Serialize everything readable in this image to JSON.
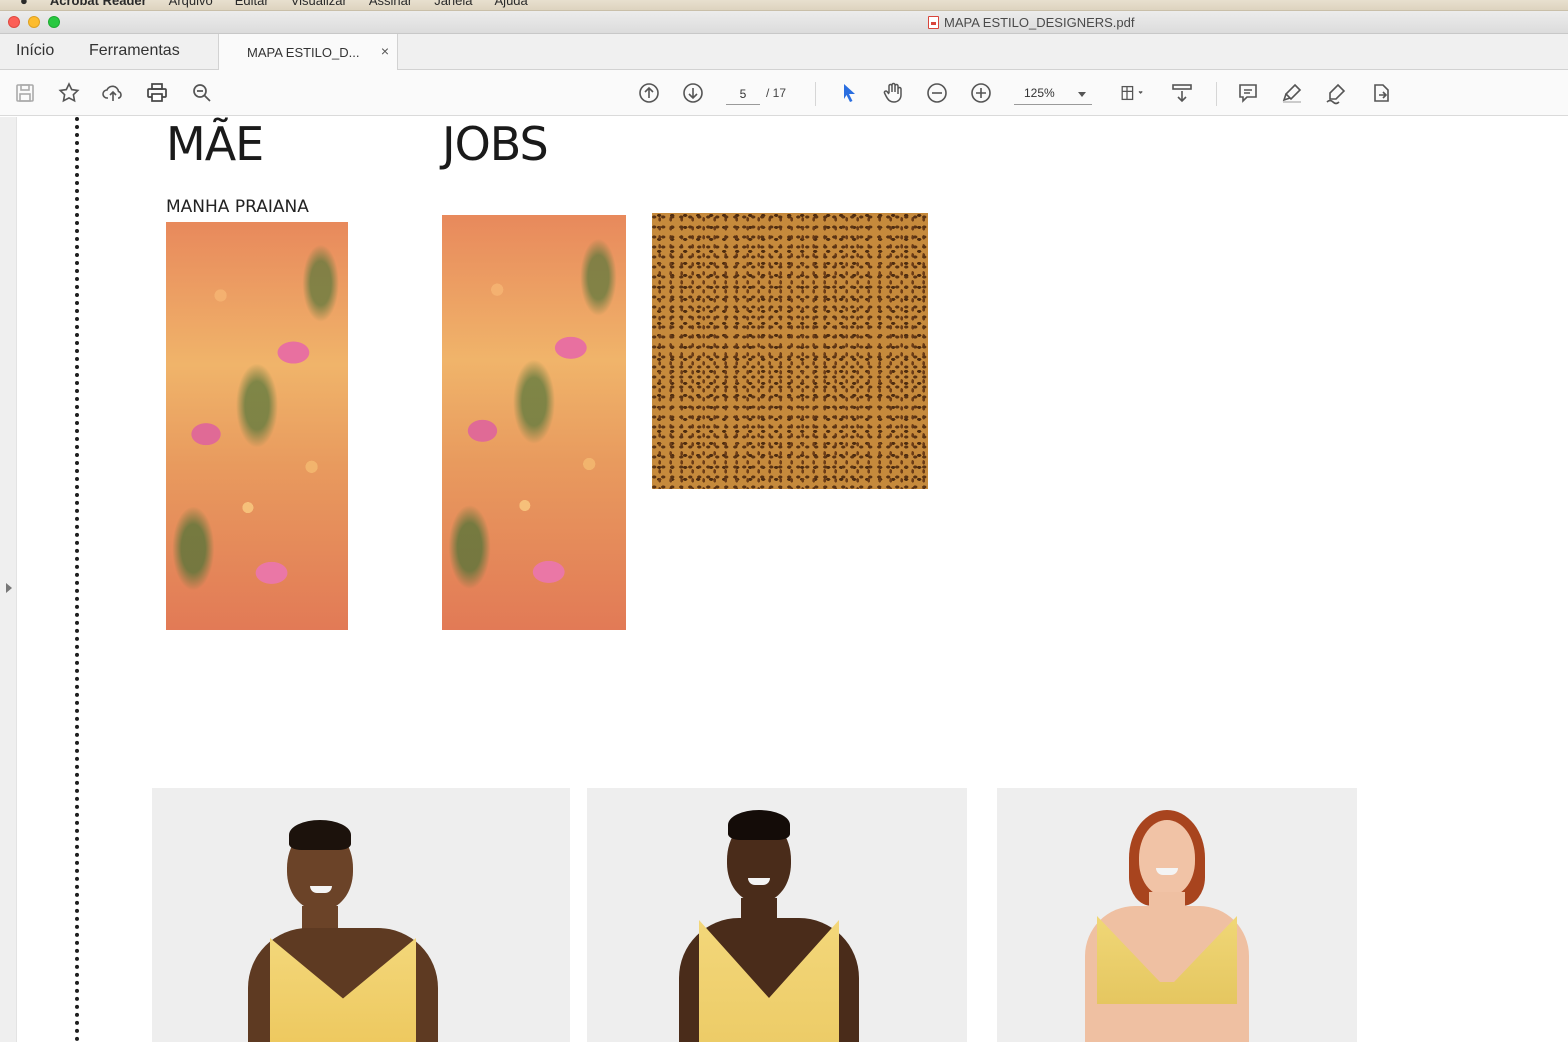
{
  "menubar": {
    "apple_icon": "apple-icon",
    "items": [
      "Acrobat Reader",
      "Arquivo",
      "Editar",
      "Visualizar",
      "Assinar",
      "Janela",
      "Ajuda"
    ]
  },
  "window": {
    "title": "MAPA ESTILO_DESIGNERS.pdf"
  },
  "tabs": {
    "home": "Início",
    "tools": "Ferramentas",
    "document": "MAPA ESTILO_D...",
    "close": "×"
  },
  "toolbar": {
    "current_page": "5",
    "total_pages": "/ 17",
    "zoom": "125%",
    "icons": [
      "save-icon",
      "star-icon",
      "upload-cloud-icon",
      "print-icon",
      "zoom-search-icon",
      "arrow-up-circle-icon",
      "arrow-down-circle-icon",
      "select-cursor-icon",
      "hand-icon",
      "zoom-out-icon",
      "zoom-in-icon",
      "page-fit-icon",
      "scroll-mode-icon",
      "comment-icon",
      "highlight-pen-icon",
      "sign-icon",
      "share-icon"
    ]
  },
  "page": {
    "heading_left": "MÃE",
    "heading_right": "JOBS",
    "subheading": "MANHA PRAIANA"
  },
  "colors": {
    "accent_blue": "#2a6ee0",
    "floral_base": "#e8895c",
    "leopard_base": "#c68a3c"
  }
}
